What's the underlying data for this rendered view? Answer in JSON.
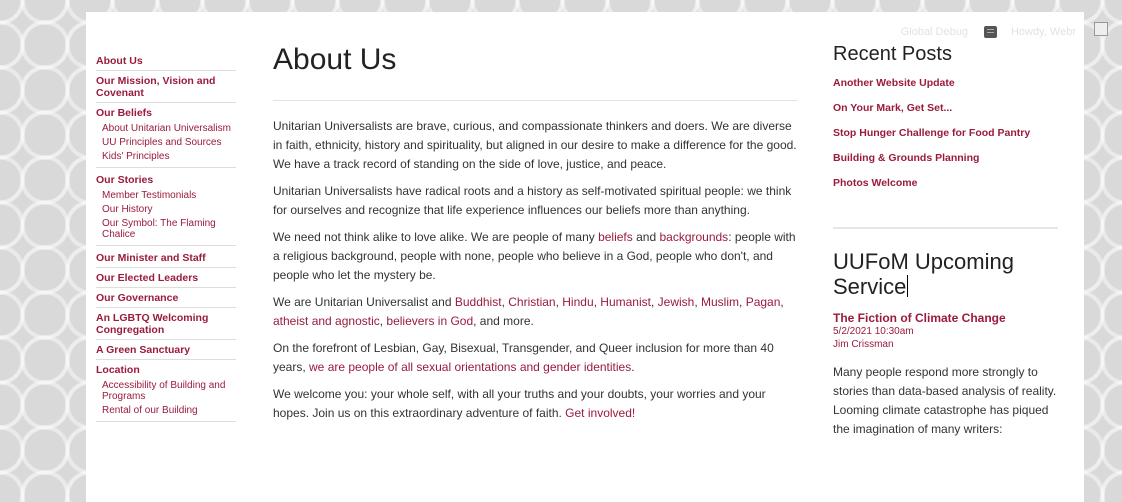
{
  "adminbar": {
    "debug_label": "Global Debug",
    "howdy_label": "Howdy, Webr"
  },
  "leftnav": {
    "items": [
      {
        "label": "About Us"
      },
      {
        "label": "Our Mission, Vision and Covenant"
      },
      {
        "label": "Our Beliefs",
        "children": [
          "About Unitarian Universalism",
          "UU Principles and Sources",
          "Kids' Principles"
        ]
      },
      {
        "label": "Our Stories",
        "children": [
          "Member Testimonials",
          "Our History",
          "Our Symbol: The Flaming Chalice"
        ]
      },
      {
        "label": "Our Minister and Staff"
      },
      {
        "label": "Our Elected Leaders"
      },
      {
        "label": "Our Governance"
      },
      {
        "label": "An LGBTQ Welcoming Congregation"
      },
      {
        "label": "A Green Sanctuary"
      },
      {
        "label": "Location",
        "children": [
          "Accessibility of Building and Programs",
          "Rental of our Building"
        ]
      }
    ]
  },
  "main": {
    "title": "About Us",
    "p1": "Unitarian Universalists are brave, curious, and compassionate thinkers and doers. We are diverse in faith, ethnicity, history and spirituality, but aligned in our desire to make a difference for the good. We have a track record of standing on the side of love, justice, and peace.",
    "p2": "Unitarian Universalists have radical roots and a history as self-motivated spiritual people: we think for ourselves and recognize that life experience influences our beliefs more than anything.",
    "p3": {
      "t1": "We need not think alike to love alike. We are people of many ",
      "l1": "beliefs",
      "t2": " and ",
      "l2": "backgrounds",
      "t3": ": people with a religious background, people with none, people who believe in a God, people who don't, and people who let the mystery be."
    },
    "p4": {
      "t1": "We are Unitarian Universalist and ",
      "links": [
        "Buddhist",
        "Christian",
        "Hindu",
        "Humanist",
        "Jewish",
        "Muslim",
        "Pagan",
        "atheist and agnostic",
        "believers in God"
      ],
      "t2": ", and more."
    },
    "p5": {
      "t1": "On the forefront of Lesbian, Gay, Bisexual, Transgender, and Queer inclusion for more than 40 years, ",
      "l1": "we are people of all sexual orientations and gender identities",
      "t2": "."
    },
    "p6": {
      "t1": "We welcome you: your whole self, with all your truths and your doubts, your worries and your hopes. Join us on this extraordinary adventure of faith. ",
      "l1": "Get involved!"
    }
  },
  "sidebar": {
    "recent_title": "Recent Posts",
    "recent_posts": [
      "Another Website Update",
      "On Your Mark, Get Set...",
      "Stop Hunger Challenge for Food Pantry",
      "Building & Grounds Planning",
      "Photos Welcome"
    ],
    "service_title": "UUFoM Upcoming Service",
    "event": {
      "title": "The Fiction of Climate Change",
      "datetime": "5/2/2021 10:30am",
      "author": "Jim Crissman",
      "description": "Many people respond more strongly to stories than data-based analysis of reality. Looming climate catastrophe has piqued the imagination of many writers:"
    }
  },
  "colors": {
    "accent": "#9a1b3d",
    "text": "#333333",
    "heading": "#222222"
  }
}
